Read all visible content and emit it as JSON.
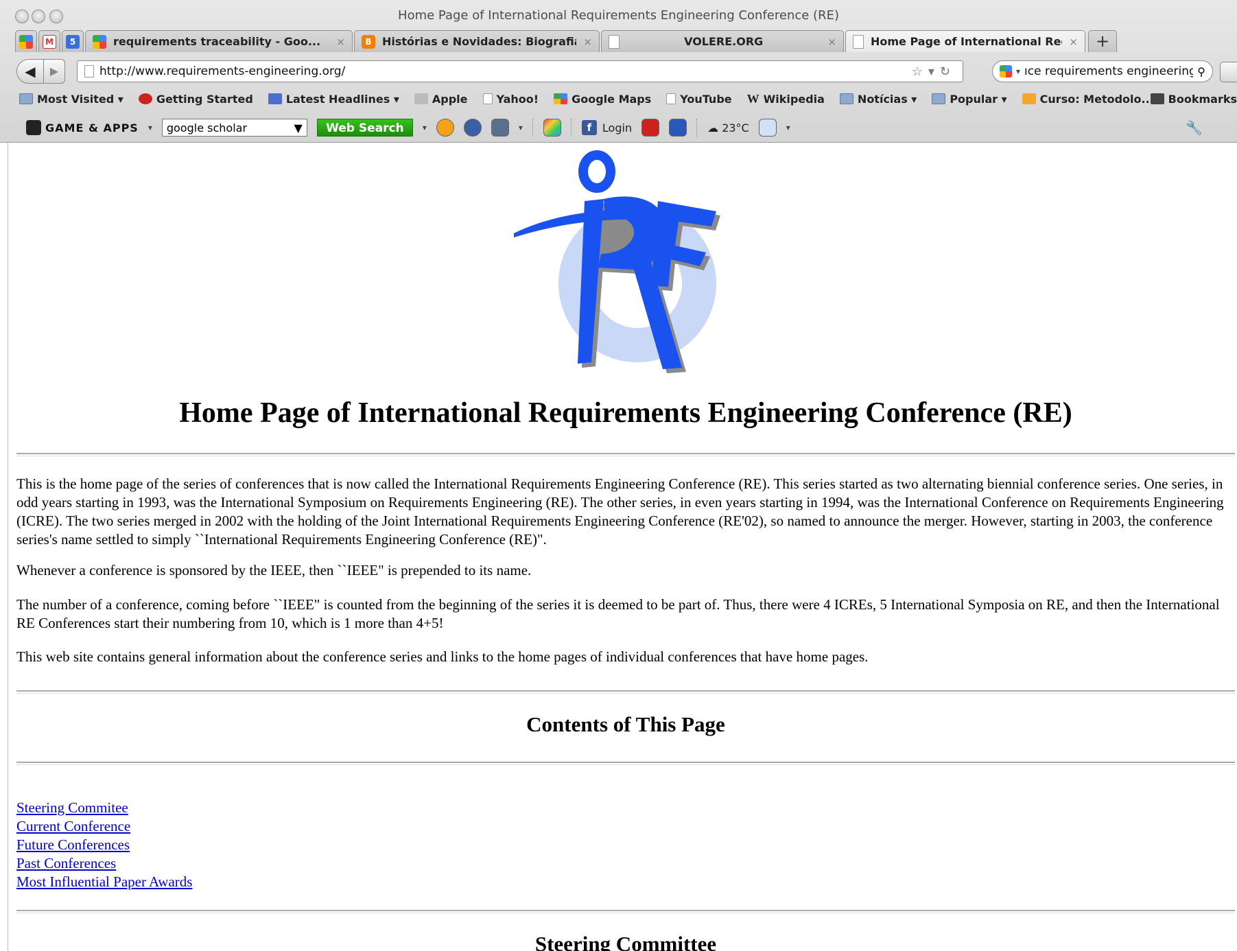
{
  "window": {
    "title": "Home Page of International Requirements Engineering Conference (RE)"
  },
  "tabs": [
    {
      "label": "requirements traceability - Goo...",
      "favicon": "google-icon"
    },
    {
      "label": "Histórias e Novidades: Biografia...",
      "favicon": "blogger-icon"
    },
    {
      "label": "VOLERE.ORG",
      "favicon": "blank-page-icon"
    },
    {
      "label": "Home Page of International Req...",
      "favicon": "page-icon",
      "active": true
    }
  ],
  "tab_close_glyph": "×",
  "new_tab_glyph": "+",
  "navbar": {
    "url": "http://www.requirements-engineering.org/",
    "search_value": "ıce requirements engineering"
  },
  "bookmarks": [
    "Most Visited ▾",
    "Getting Started",
    "Latest Headlines ▾",
    "Apple",
    "Yahoo!",
    "Google Maps",
    "YouTube",
    "Wikipedia",
    "Notícias ▾",
    "Popular ▾",
    "Curso: Metodolo..."
  ],
  "bookmarks_menu": "Bookmarks",
  "toolbar": {
    "brand": "GAME & APPS",
    "search_select": "google scholar",
    "web_search": "Web Search",
    "login": "Login",
    "temperature": "23°C"
  },
  "content": {
    "heading": "Home Page of International Requirements Engineering Conference (RE)",
    "paragraphs": [
      "This is the home page of the series of conferences that is now called the International Requirements Engineering Conference (RE). This series started as two alternating biennial conference series. One series, in odd years starting in 1993, was the International Symposium on Requirements Engineering (RE). The other series, in even years starting in 1994, was the International Conference on Requirements Engineering (ICRE). The two series merged in 2002 with the holding of the Joint International Requirements Engineering Conference (RE'02), so named to announce the merger. However, starting in 2003, the conference series's name settled to simply ``International Requirements Engineering Conference (RE)\".",
      "Whenever a conference is sponsored by the IEEE, then ``IEEE\" is prepended to its name.",
      "The number of a conference, coming before ``IEEE\" is counted from the beginning of the series it is deemed to be part of. Thus, there were 4 ICREs, 5 International Symposia on RE, and then the International RE Conferences start their numbering from 10, which is 1 more than 4+5!",
      "This web site contains general information about the conference series and links to the home pages of individual conferences that have home pages."
    ],
    "contents_heading": "Contents of This Page",
    "links": [
      "Steering Commitee",
      "Current Conference",
      "Future Conferences",
      "Past Conferences",
      "Most Influential Paper Awards"
    ],
    "steering_heading": "Steering Committee"
  },
  "colors": {
    "logo_blue": "#1a52f0",
    "logo_gear": "#c9d8f7",
    "link": "#0000cc"
  }
}
